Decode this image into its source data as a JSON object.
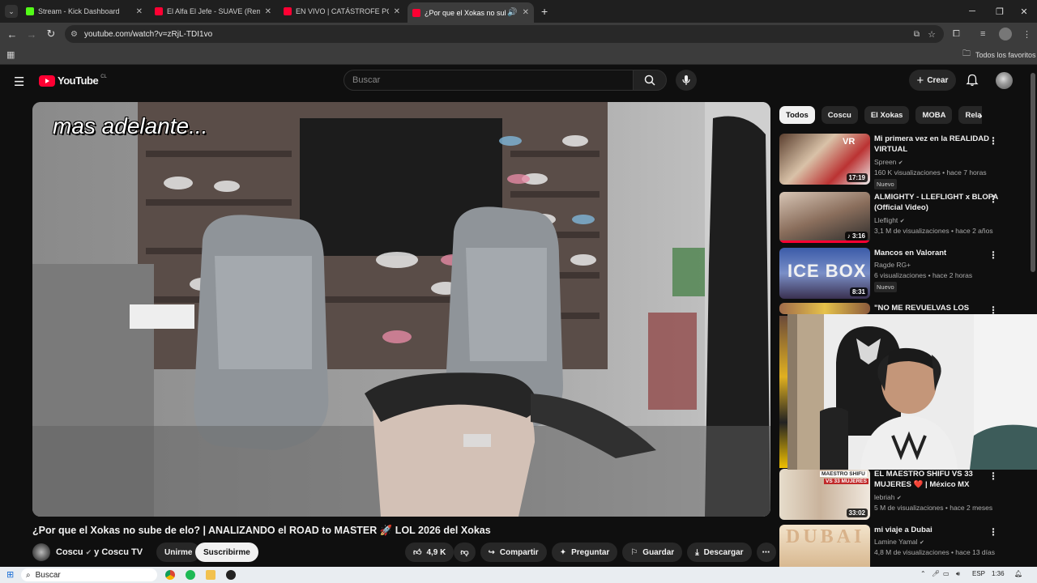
{
  "browser": {
    "tabs": [
      {
        "label": "Stream - Kick Dashboard",
        "color": "#53fc18"
      },
      {
        "label": "El Alfa El Jefe - SUAVE (Remix) Ft",
        "color": "#ff0033"
      },
      {
        "label": "EN VIVO | CATÁSTROFE POR INUNDACIÓN",
        "color": "#ff0033"
      },
      {
        "label": "¿Por que el Xokas no sube d",
        "color": "#ff0033"
      }
    ],
    "url": "youtube.com/watch?v=zRjL-TDI1vo",
    "bookmarks_folder": "Todos los favoritos"
  },
  "youtube": {
    "logo_text": "YouTube",
    "country_code": "CL",
    "search_placeholder": "Buscar",
    "create_label": "Crear"
  },
  "video": {
    "overlay_text": "mas adelante...",
    "title": "¿Por que el Xokas no sube de elo? | ANALIZANDO el ROAD to MASTER 🚀 LOL 2026 del Xokas",
    "channel": "Coscu",
    "channel_suffix": "y Coscu TV",
    "join_label": "Unirme",
    "subscribe_label": "Suscribirme",
    "likes": "4,9 K",
    "share_label": "Compartir",
    "ask_label": "Preguntar",
    "save_label": "Guardar",
    "download_label": "Descargar"
  },
  "chips": [
    "Todos",
    "Coscu",
    "El Xokas",
    "MOBA",
    "Relacionado"
  ],
  "recommendations": [
    {
      "title": "Mi primera vez en la REALIDAD VIRTUAL",
      "channel": "Spreen",
      "meta": "160 K visualizaciones • hace 7 horas",
      "duration": "17:19",
      "badge": "Nuevo"
    },
    {
      "title": "ALMIGHTY - LLEFLIGHT x BLOPA (Official Video)",
      "channel": "Lleflight",
      "meta": "3,1 M de visualizaciones • hace 2 años",
      "duration": "3:16",
      "badge": ""
    },
    {
      "title": "Mancos en Valorant",
      "channel": "Ragde RG+",
      "meta": "6 visualizaciones • hace 2 horas",
      "duration": "8:31",
      "badge": "Nuevo"
    },
    {
      "title": "\"NO ME REVUELVAS LOS",
      "channel": "",
      "meta": "",
      "duration": "",
      "badge": ""
    },
    {
      "title": "EL MAESTRO SHIFU VS 33 MUJERES ❤️ | México MX",
      "channel": "lebriah",
      "meta": "5 M de visualizaciones • hace 2 meses",
      "duration": "33:02",
      "badge": ""
    },
    {
      "title": "mi viaje a Dubai",
      "channel": "Lamine Yamal",
      "meta": "4,8 M de visualizaciones • hace 13 días",
      "duration": "",
      "badge": ""
    }
  ],
  "thumb_text": {
    "vr": "VR",
    "ice": "ICE BOX",
    "shifu1": "MAESTRO SHIFU",
    "shifu2": "VS 33 MUJERES",
    "dubai": "DUBAI"
  },
  "taskbar": {
    "search_label": "Buscar",
    "lang": "ESP",
    "time": "1:36"
  }
}
